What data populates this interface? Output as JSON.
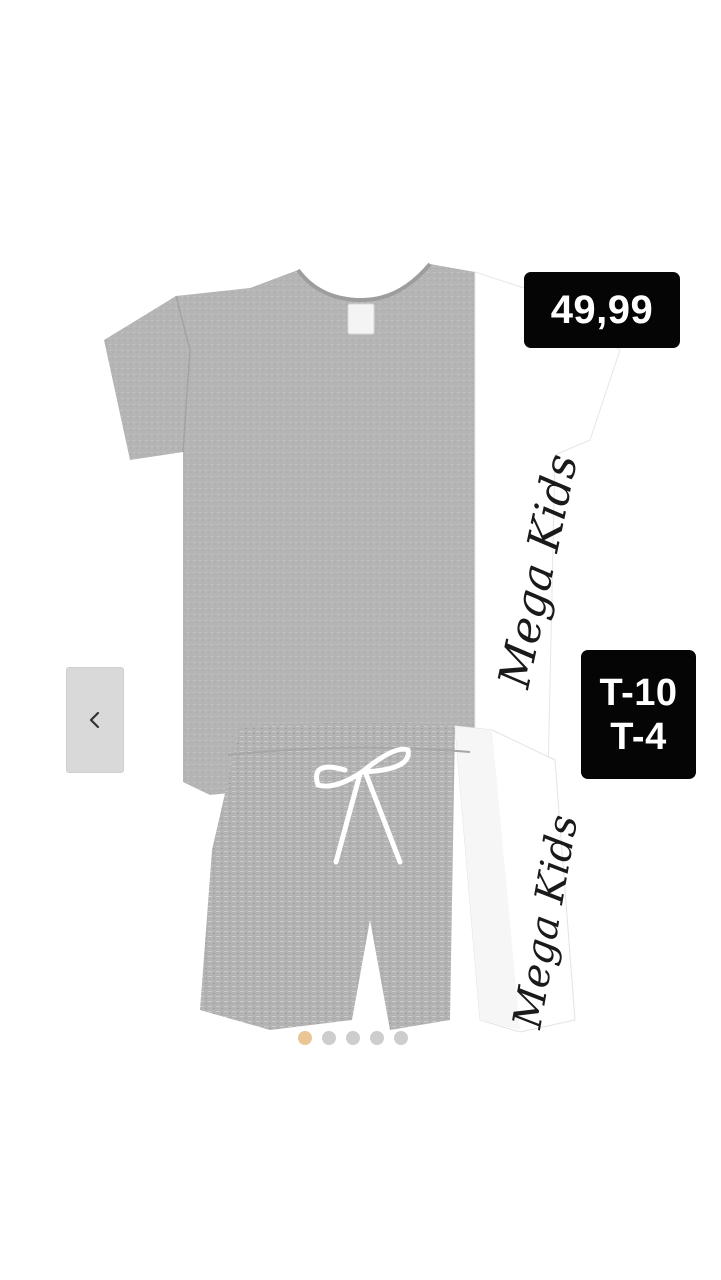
{
  "product": {
    "image_alt_icon": "kids-tshirt-shorts-set-illustration",
    "brand_text": "Mega Kids",
    "price": "49,99",
    "sizes": [
      "T-10",
      "T-4"
    ]
  },
  "carousel": {
    "prev_icon": "chevron-left-icon",
    "slide_count": 5,
    "active_index": 0
  },
  "colors": {
    "badge_bg": "#050505",
    "badge_text": "#ffffff",
    "fabric_gray": "#b3b3b3",
    "panel_white": "#ffffff"
  }
}
